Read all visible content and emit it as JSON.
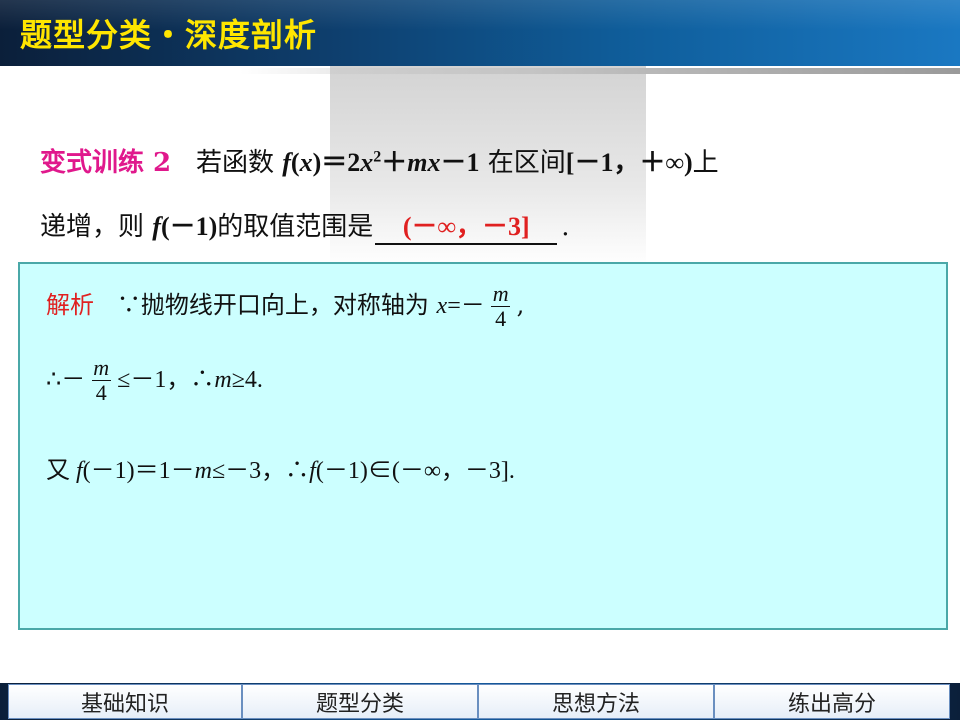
{
  "header": {
    "title": "题型分类・深度剖析"
  },
  "problem": {
    "label": "变式训练 2",
    "text_a": "若函数",
    "func_a": "f",
    "func_b": "(",
    "func_c": "x",
    "func_d": ")＝2",
    "func_e": "x",
    "func_exp": "2",
    "func_f": "＋",
    "func_g": "mx",
    "func_h": "－1",
    "text_b": "在区间",
    "interval": "[－1，＋∞)",
    "text_c": "上",
    "text_d": "递增，则",
    "fm_a": "f",
    "fm_b": "(－1)",
    "text_e": "的取值范围是",
    "answer": "(－∞，－3]",
    "end": "."
  },
  "solution": {
    "label": "解析",
    "l1_a": "∵抛物线开口向上，对称轴为",
    "l1_x": "x",
    "l1_b": "=－",
    "frac_num": "m",
    "frac_den": "4",
    "l1_c": ",",
    "l2_a": "∴－",
    "l2_b": "≤－1，∴",
    "l2_m": "m",
    "l2_c": "≥4.",
    "l3_a": "又",
    "l3_f": "f",
    "l3_b": "(－1)＝1－",
    "l3_m": "m",
    "l3_c": "≤－3，∴",
    "l3_f2": "f",
    "l3_d": "(－1)∈(－∞，－3]."
  },
  "nav": {
    "items": [
      "基础知识",
      "题型分类",
      "思想方法",
      "练出高分"
    ]
  },
  "colors": {
    "title": "#ffe600",
    "label": "#e0188c",
    "answer": "#e02020",
    "solution_bg": "#ccffff"
  }
}
